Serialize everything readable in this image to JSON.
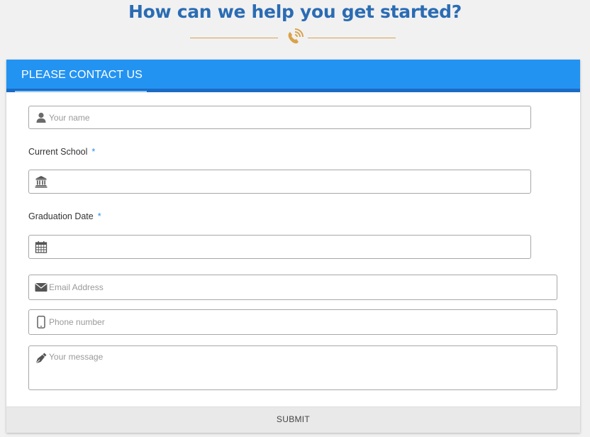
{
  "page": {
    "title": "How can we help you get started?",
    "accent_color": "#d9a24a",
    "title_color": "#2b6cb3"
  },
  "card": {
    "header": {
      "tab_label": "PLEASE CONTACT US",
      "bg_color": "#2393f2"
    },
    "fields": {
      "name": {
        "placeholder": "Your name",
        "icon": "user-icon"
      },
      "school": {
        "label": "Current School",
        "required_mark": "*",
        "icon": "institution-icon"
      },
      "graduation": {
        "label": "Graduation Date",
        "required_mark": "*",
        "icon": "calendar-icon"
      },
      "email": {
        "placeholder": "Email Address",
        "icon": "envelope-icon"
      },
      "phone": {
        "placeholder": "Phone number",
        "icon": "mobile-phone-icon"
      },
      "message": {
        "placeholder": "Your message",
        "icon": "pen-icon"
      }
    },
    "submit_label": "SUBMIT"
  }
}
